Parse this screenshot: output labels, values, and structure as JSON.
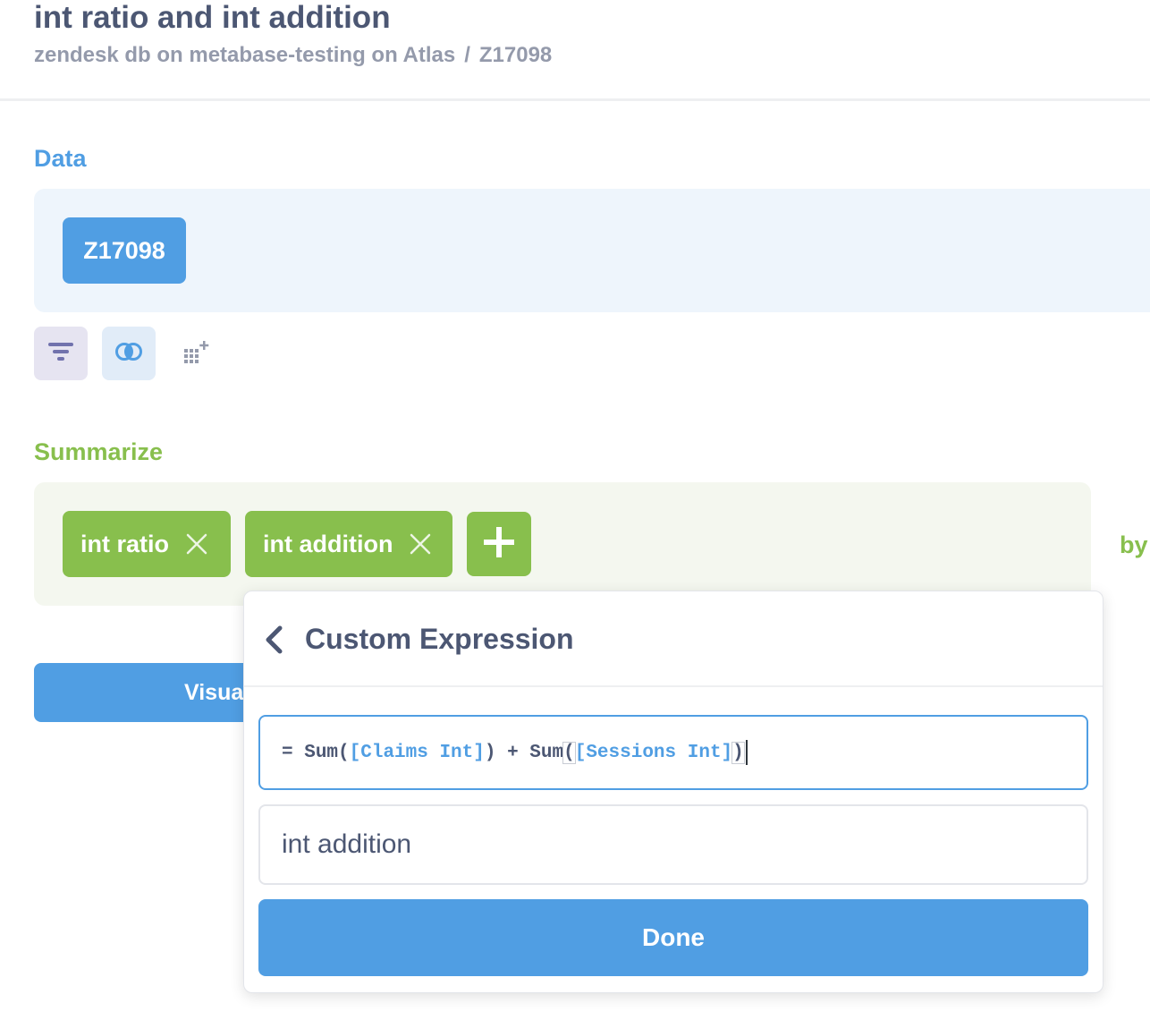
{
  "header": {
    "title": "int ratio and int addition",
    "breadcrumb": {
      "database": "zendesk db on metabase-testing on Atlas",
      "separator": "/",
      "table": "Z17098"
    }
  },
  "data_section": {
    "label": "Data",
    "table_name": "Z17098",
    "actions": [
      {
        "icon": "filter-icon"
      },
      {
        "icon": "join-icon"
      },
      {
        "icon": "custom-column-icon"
      }
    ]
  },
  "summarize_section": {
    "label": "Summarize",
    "metrics": [
      {
        "label": "int ratio"
      },
      {
        "label": "int addition"
      }
    ],
    "add_icon": "plus-icon",
    "by_label": "by"
  },
  "visualize_button": {
    "label": "Visua"
  },
  "custom_expression_popover": {
    "title": "Custom Expression",
    "expression": {
      "prefix": "= ",
      "fn1": "Sum(",
      "field1": "[Claims Int]",
      "close1": ")",
      "plus": " + ",
      "fn2": "Sum",
      "open2": "(",
      "field2": "[Sessions Int]",
      "close2": ")"
    },
    "name_value": "int addition",
    "done_label": "Done"
  },
  "colors": {
    "brand": "#509ee3",
    "summarize": "#88bf4d",
    "filter": "#7172ad",
    "text_dark": "#4c5773",
    "text_light": "#949aab"
  }
}
